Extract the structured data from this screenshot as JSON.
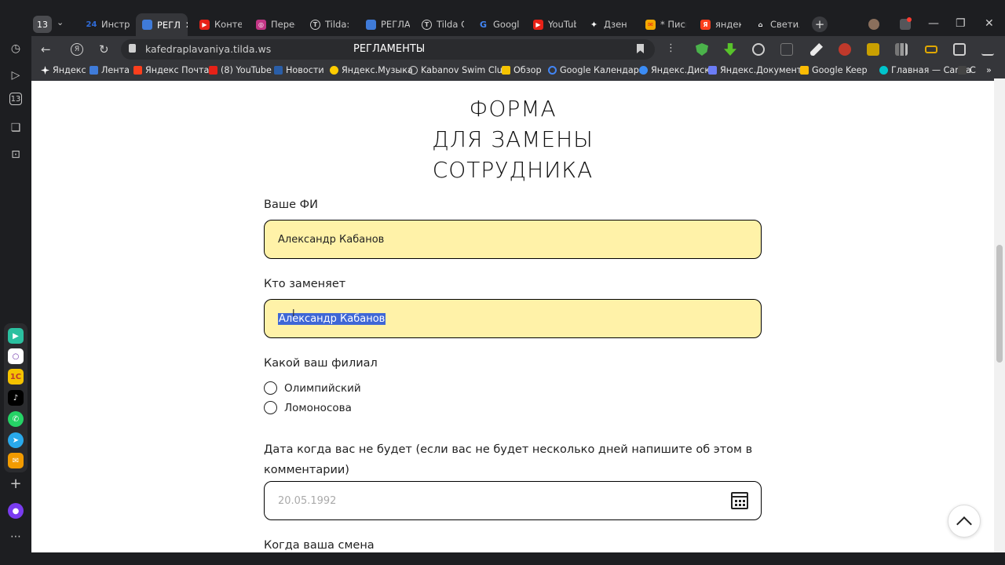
{
  "browser": {
    "tab_count": "13",
    "tabs": [
      {
        "label": "Инстр",
        "fav": "24",
        "color": "#2f6bd8"
      },
      {
        "label": "РЕГЛ",
        "fav": "",
        "color": "#3f7bd9",
        "active": true
      },
      {
        "label": "Конте",
        "fav": "▶",
        "color": "#e62117"
      },
      {
        "label": "Пересі",
        "fav": "◎",
        "color": "#c13584"
      },
      {
        "label": "Tilda: Р",
        "fav": "T",
        "color": "#555"
      },
      {
        "label": "РЕГЛАМ",
        "fav": "",
        "color": "#3f7bd9"
      },
      {
        "label": "Tilda Cl",
        "fav": "T",
        "color": "#555"
      },
      {
        "label": "Google",
        "fav": "G",
        "color": "#4285f4"
      },
      {
        "label": "YouTub",
        "fav": "▶",
        "color": "#e62117"
      },
      {
        "label": "Дзен",
        "fav": "✦",
        "color": "#222"
      },
      {
        "label": "* Письм",
        "fav": "✉",
        "color": "#f2a900"
      },
      {
        "label": "яндекс",
        "fav": "Я",
        "color": "#fc3f1d"
      },
      {
        "label": "Светил",
        "fav": "⌂",
        "color": "#444"
      }
    ],
    "url": "kafedraplavaniya.tilda.ws",
    "page_title": "РЕГЛАМЕНТЫ",
    "bookmarks": [
      {
        "label": "Яндекс",
        "color": "#fff"
      },
      {
        "label": "Лента",
        "color": "#3f7bd9"
      },
      {
        "label": "Яндекс Почта",
        "color": "#fc3f1d"
      },
      {
        "label": "(8) YouTube",
        "color": "#e62117"
      },
      {
        "label": "Новости",
        "color": "#2a5ea8"
      },
      {
        "label": "Яндекс.Музыка",
        "color": "#ffcc00"
      },
      {
        "label": "Kabanov Swim Clu",
        "color": "#777"
      },
      {
        "label": "Обзор",
        "color": "#f5c300"
      },
      {
        "label": "Google Календарь",
        "color": "#4285f4"
      },
      {
        "label": "Яндекс.Диск",
        "color": "#3b8cf5"
      },
      {
        "label": "Яндекс.Документ",
        "color": "#6b7cf5"
      },
      {
        "label": "Google Keep",
        "color": "#fbbc04"
      },
      {
        "label": "Главная — Canva",
        "color": "#00c4cc"
      },
      {
        "label": "C",
        "color": "#444"
      }
    ]
  },
  "form": {
    "title_line1": "ФОРМА",
    "title_line2": "ДЛЯ ЗАМЕНЫ",
    "title_line3": "СОТРУДНИКА",
    "name_label": "Ваше ФИ",
    "name_value": "Александр Кабанов",
    "replacer_label": "Кто заменяет",
    "replacer_value": "Александр Кабанов",
    "branch_label": "Какой ваш филиал",
    "branch_options": [
      "Олимпийский",
      "Ломоносова"
    ],
    "date_label_line1": "Дата когда вас не будет (если вас не будет несколько дней напишите об этом в",
    "date_label_line2": "комментарии)",
    "date_placeholder": "20.05.1992",
    "shift_label": "Когда ваша смена"
  }
}
